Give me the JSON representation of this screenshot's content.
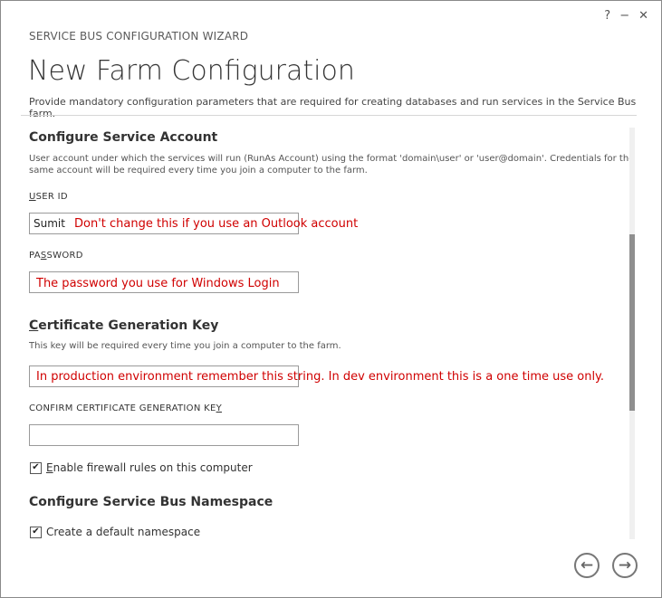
{
  "window": {
    "help_label": "?",
    "minimize_label": "−",
    "close_label": "✕",
    "wizard_title": "SERVICE BUS CONFIGURATION WIZARD"
  },
  "header": {
    "title": "New Farm Configuration",
    "subtitle": "Provide mandatory configuration parameters that are required for creating databases and run services in the Service Bus farm."
  },
  "service_account": {
    "heading": "Configure Service Account",
    "description_line1": "User account under which the services will run (RunAs Account) using the format 'domain\\user' or 'user@domain'. Credentials for the",
    "description_line2": "same account will be required every time you join a computer to the farm.",
    "user_id_label_u": "U",
    "user_id_label_rest": "SER ID",
    "user_id_value": "Sumit",
    "user_id_note": "Don't change this if you use an Outlook account",
    "password_label_pre": "PA",
    "password_label_u": "S",
    "password_label_rest": "SWORD",
    "password_note": "The password you use for Windows Login"
  },
  "certificate": {
    "heading_u": "C",
    "heading_rest": "ertificate Generation Key",
    "description": "This key will be required every time you join a computer to the farm.",
    "key_note": "In production environment remember this string. In dev environment this is a one time use only.",
    "confirm_label_pre": "CONFIRM CERTIFICATE GENERATION KE",
    "confirm_label_u": "Y"
  },
  "firewall": {
    "checked_glyph": "✔",
    "label_u": "E",
    "label_rest": "nable firewall rules on this computer"
  },
  "namespace": {
    "heading": "Configure Service Bus Namespace",
    "checked_glyph": "✔",
    "label": "Create a default namespace"
  },
  "nav": {
    "back_glyph": "←",
    "next_glyph": "→"
  }
}
